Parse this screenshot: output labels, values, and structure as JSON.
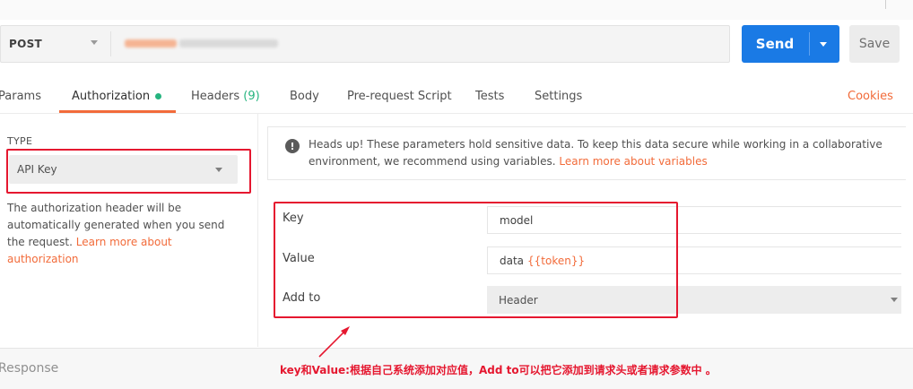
{
  "request": {
    "method": "POST"
  },
  "buttons": {
    "send": "Send",
    "save": "Save"
  },
  "tabs": [
    {
      "label": "Params"
    },
    {
      "label": "Authorization"
    },
    {
      "label": "Headers",
      "count": "(9)"
    },
    {
      "label": "Body"
    },
    {
      "label": "Pre-request Script"
    },
    {
      "label": "Tests"
    },
    {
      "label": "Settings"
    }
  ],
  "cookies_link": "Cookies",
  "auth": {
    "type_label": "TYPE",
    "type_value": "API Key",
    "description": "The authorization header will be automatically generated when you send the request.",
    "learn_more": "Learn more about authorization"
  },
  "notice": {
    "text": "Heads up! These parameters hold sensitive data. To keep this data secure while working in a collaborative environment, we recommend using variables.",
    "link": "Learn more about variables"
  },
  "fields": [
    {
      "key": "Key",
      "value": "model"
    },
    {
      "key": "Value",
      "value": "data",
      "variable": "{{token}}"
    },
    {
      "key": "Add to",
      "value": "Header"
    }
  ],
  "response": {
    "label": "Response"
  },
  "annotation": "key和Value:根据自己系统添加对应值，Add to可以把它添加到请求头或者请求参数中 。",
  "colors": {
    "accent": "#f26b3a",
    "send": "#1a7ae5",
    "active_dot": "#26b47f",
    "highlight_box": "#e5172f"
  }
}
